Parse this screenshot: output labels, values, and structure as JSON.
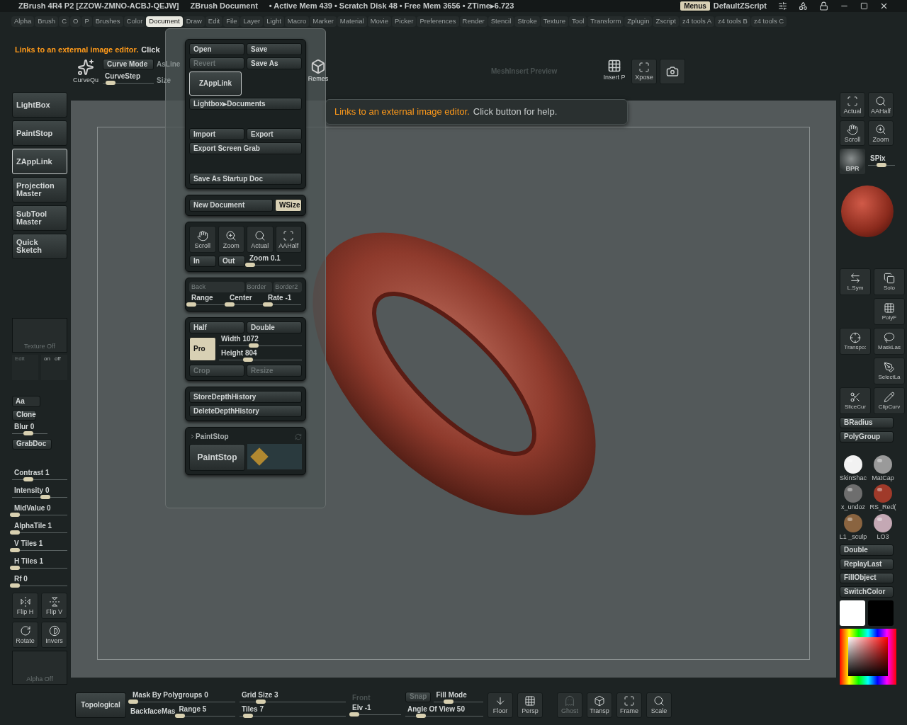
{
  "title_bar": {
    "app": "ZBrush 4R4 P2 [ZZOW-ZMNO-ACBJ-QEJW]",
    "document": "ZBrush Document",
    "stats": "• Active Mem 439 • Scratch Disk 48 • Free Mem 3656 • ZTime▸6.723",
    "menus_button": {
      "label": "Menus",
      "on": true
    },
    "script": "DefaultZScript"
  },
  "menu_bar": [
    {
      "label": "Alpha",
      "selected": false
    },
    {
      "label": "Brush",
      "selected": false
    },
    {
      "label": "C",
      "selected": false
    },
    {
      "label": "O",
      "selected": false
    },
    {
      "label": "P",
      "selected": false
    },
    {
      "label": "Brushes",
      "selected": false
    },
    {
      "label": "Color",
      "selected": false
    },
    {
      "label": "Document",
      "selected": true
    },
    {
      "label": "Draw",
      "selected": false
    },
    {
      "label": "Edit",
      "selected": false
    },
    {
      "label": "File",
      "selected": false
    },
    {
      "label": "Layer",
      "selected": false
    },
    {
      "label": "Light",
      "selected": false
    },
    {
      "label": "Macro",
      "selected": false
    },
    {
      "label": "Marker",
      "selected": false
    },
    {
      "label": "Material",
      "selected": false
    },
    {
      "label": "Movie",
      "selected": false
    },
    {
      "label": "Picker",
      "selected": false
    },
    {
      "label": "Preferences",
      "selected": false
    },
    {
      "label": "Render",
      "selected": false
    },
    {
      "label": "Stencil",
      "selected": false
    },
    {
      "label": "Stroke",
      "selected": false
    },
    {
      "label": "Texture",
      "selected": false
    },
    {
      "label": "Tool",
      "selected": false
    },
    {
      "label": "Transform",
      "selected": false
    },
    {
      "label": "Zplugin",
      "selected": false
    },
    {
      "label": "Zscript",
      "selected": false
    },
    {
      "label": "z4 tools A",
      "selected": false
    },
    {
      "label": "z4 tools B",
      "selected": false
    },
    {
      "label": "z4 tools C",
      "selected": false
    }
  ],
  "hint": {
    "title": "Links to an external image editor.",
    "more": "Click"
  },
  "top_shelf": {
    "curve_brush": "CurveQu",
    "curve_mode": "Curve Mode",
    "as_line": "AsLine",
    "curve_step": {
      "label": "CurveStep",
      "level": 0.15
    },
    "size": "Size",
    "remesh": "Remes",
    "preview": "MeshInsert Preview",
    "insert": "Insert P",
    "xpose": "Xpose"
  },
  "left_tray": {
    "buttons": [
      {
        "label": "LightBox",
        "selected": false
      },
      {
        "label": "PaintStop",
        "selected": false
      },
      {
        "label": "ZAppLink",
        "selected": true
      },
      {
        "label": "Projection Master",
        "selected": false
      },
      {
        "label": "SubTool Master",
        "selected": false
      },
      {
        "label": "Quick Sketch",
        "selected": false
      }
    ],
    "texture": "Texture Off",
    "edit": "Edit",
    "on": "on",
    "off": "off",
    "aa": "Aa",
    "clone": "Clone",
    "blur": {
      "label": "Blur 0",
      "level": 0.45
    },
    "grabdoc": "GrabDoc",
    "sliders": [
      {
        "label": "Contrast 1",
        "level": 0.3
      },
      {
        "label": "Intensity 0",
        "level": 0.6
      },
      {
        "label": "MidValue 0",
        "level": 0.05
      },
      {
        "label": "AlphaTile 1",
        "level": 0.05
      },
      {
        "label": "V Tiles 1",
        "level": 0.05
      },
      {
        "label": "H Tiles 1",
        "level": 0.05
      },
      {
        "label": "Rf 0",
        "level": 0.05
      }
    ],
    "tools": [
      "Flip H",
      "Flip V",
      "Rotate",
      "Invers"
    ],
    "alpha": "Alpha Off"
  },
  "document_menu": {
    "open": "Open",
    "save": "Save",
    "revert": {
      "label": "Revert",
      "disabled": true
    },
    "save_as": "Save As",
    "zapplink": "ZAppLink",
    "lightbox_docs": "Lightbox▸Documents",
    "import": "Import",
    "export": "Export",
    "export_grab": "Export Screen Grab",
    "startup": "Save As Startup Doc",
    "new_doc": "New Document",
    "wsize": {
      "label": "WSize",
      "on": true
    },
    "view_tools": [
      "Scroll",
      "Zoom",
      "Actual",
      "AAHalf"
    ],
    "zoom_in": "In",
    "zoom_out": "Out",
    "zoom": {
      "label": "Zoom 0.1",
      "level": 0.05
    },
    "back": "Back",
    "border": "Border",
    "border2": "Border2",
    "range": {
      "label": "Range",
      "level": 0.05
    },
    "center": {
      "label": "Center",
      "level": 0.05
    },
    "rate": {
      "label": "Rate -1",
      "level": 0.05
    },
    "half": "Half",
    "double": "Double",
    "pro": {
      "label": "Pro",
      "on": true
    },
    "width": {
      "label": "Width 1072",
      "level": 0.42
    },
    "height": {
      "label": "Height 804",
      "level": 0.35
    },
    "crop": {
      "label": "Crop",
      "disabled": true
    },
    "resize": {
      "label": "Resize",
      "disabled": true
    },
    "store_depth": "StoreDepthHistory",
    "delete_depth": "DeleteDepthHistory",
    "paintstop_header": "PaintStop",
    "paintstop_button": "PaintStop"
  },
  "tooltip": {
    "title": "Links to an external image editor.",
    "text": "Click button for help."
  },
  "right_tray": {
    "view_tools": [
      "Actual",
      "AAHalf",
      "Scroll",
      "Zoom"
    ],
    "bpr": "BPR",
    "spix": {
      "label": "SPix",
      "level": 0.5
    },
    "tools": [
      "L.Sym",
      "Solo",
      "PolyF",
      "Transpo:",
      "MaskLas",
      "SelectLa",
      "SliceCur",
      "ClipCurv"
    ],
    "buttons1": [
      "BRadius",
      "PolyGroup"
    ],
    "materials": [
      {
        "label": "SkinShac",
        "color": "#f2f2f2"
      },
      {
        "label": "MatCap",
        "color": "#9a9a9a"
      },
      {
        "label": "x_undoz",
        "color": "#6e6e6e"
      },
      {
        "label": "RS_Red(",
        "color": "#a03a2a"
      },
      {
        "label": "L1 _sculp",
        "color": "#8a6440"
      },
      {
        "label": "LO3",
        "color": "#c4a8b4"
      }
    ],
    "buttons2": [
      "Double",
      "ReplayLast",
      "FillObject",
      "SwitchColor"
    ]
  },
  "bottom_shelf": {
    "topological": "Topological",
    "mask_polygroups": {
      "label": "Mask By Polygroups 0",
      "level": 0.03
    },
    "backface": "BackfaceMas",
    "range": {
      "label": "Range 5",
      "level": 0.05
    },
    "grid_size": {
      "label": "Grid Size 3",
      "level": 0.2
    },
    "tiles": {
      "label": "Tiles 7",
      "level": 0.08
    },
    "front": "Front",
    "elv": {
      "label": "Elv -1",
      "level": 0.08
    },
    "snap": {
      "label": "Snap",
      "disabled": true
    },
    "fill_mode": {
      "label": "Fill Mode",
      "level": 0.3
    },
    "angle": {
      "label": "Angle Of View 50",
      "level": 0.2
    },
    "tools": [
      {
        "label": "Floor",
        "disabled": false
      },
      {
        "label": "Persp",
        "disabled": false
      },
      {
        "label": "Ghost",
        "disabled": true
      },
      {
        "label": "Transp",
        "disabled": false
      },
      {
        "label": "Frame",
        "disabled": false
      },
      {
        "label": "Scale",
        "disabled": false
      }
    ]
  }
}
